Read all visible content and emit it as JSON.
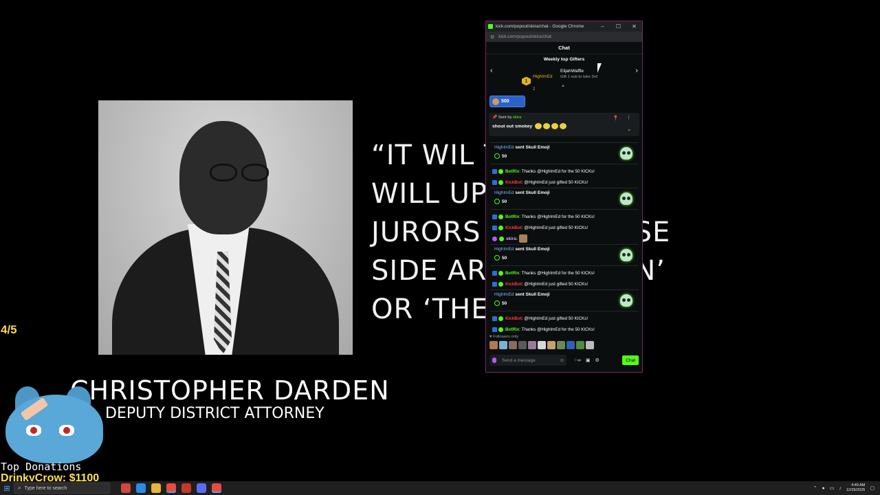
{
  "overlay": {
    "slide_counter": "4/5",
    "name": "CHRISTOPHER DARDEN",
    "role": "DEPUTY DISTRICT ATTORNEY",
    "quote": "“IT WIL          THING. IT\nWILL UP            BLACK\nJURORS             SAY, WHOSE\nSIDE AR            , ‘THE MAN’\nOR ‘THE            RS’?”",
    "donations_header": "Top Donations",
    "donations_entry": "DrinkyCrow: $1100"
  },
  "window": {
    "title": "kick.com/popout/skira/chat - Google Chrome",
    "url": "kick.com/popout/skira/chat",
    "min_symbol": "–",
    "max_symbol": "☐",
    "close_symbol": "✕"
  },
  "chat": {
    "header": "Chat",
    "gifters_title": "Weekly top Gifters",
    "gifter_1": {
      "rank": "1",
      "name": "HighImEd",
      "count": "2"
    },
    "gifter_2": {
      "name": "ElijahWaffle",
      "note": "Gift 1 sub to take 3rd"
    },
    "kicks_pill": "500",
    "pinned": {
      "sent_by": "Sent by",
      "sender": "skira",
      "message": "shout out smokey"
    },
    "gifts": [
      {
        "user": "HighImEd",
        "action": "sent Skull Emoji",
        "amount": "50"
      },
      {
        "user": "HighImEd",
        "action": "sent Skull Emoji",
        "amount": "50"
      },
      {
        "user": "HighImEd",
        "action": "sent Skull Emoji",
        "amount": "50"
      },
      {
        "user": "HighImEd",
        "action": "sent Skull Emoji",
        "amount": "50"
      }
    ],
    "lines": {
      "botrix_user": "BotRix",
      "botrix_msg": ": Thanks @HighImEd for the 50 KICKs!",
      "kickbot_user": "KickBot",
      "kickbot_msg": ": @HighImEd just gifted 50 KICKs!",
      "skira_user": "skira:"
    },
    "followers_only": "Followers only",
    "input_placeholder": "Send a message",
    "send_label": "Chat"
  },
  "taskbar": {
    "search_placeholder": "Type here to search",
    "time": "4:49 AM",
    "date": "12/29/2025"
  },
  "colors": {
    "kick_green": "#53fc18",
    "gold": "#e8b11e",
    "quote_text": "#f2f2f2",
    "donation_yellow": "#ffe14d"
  }
}
